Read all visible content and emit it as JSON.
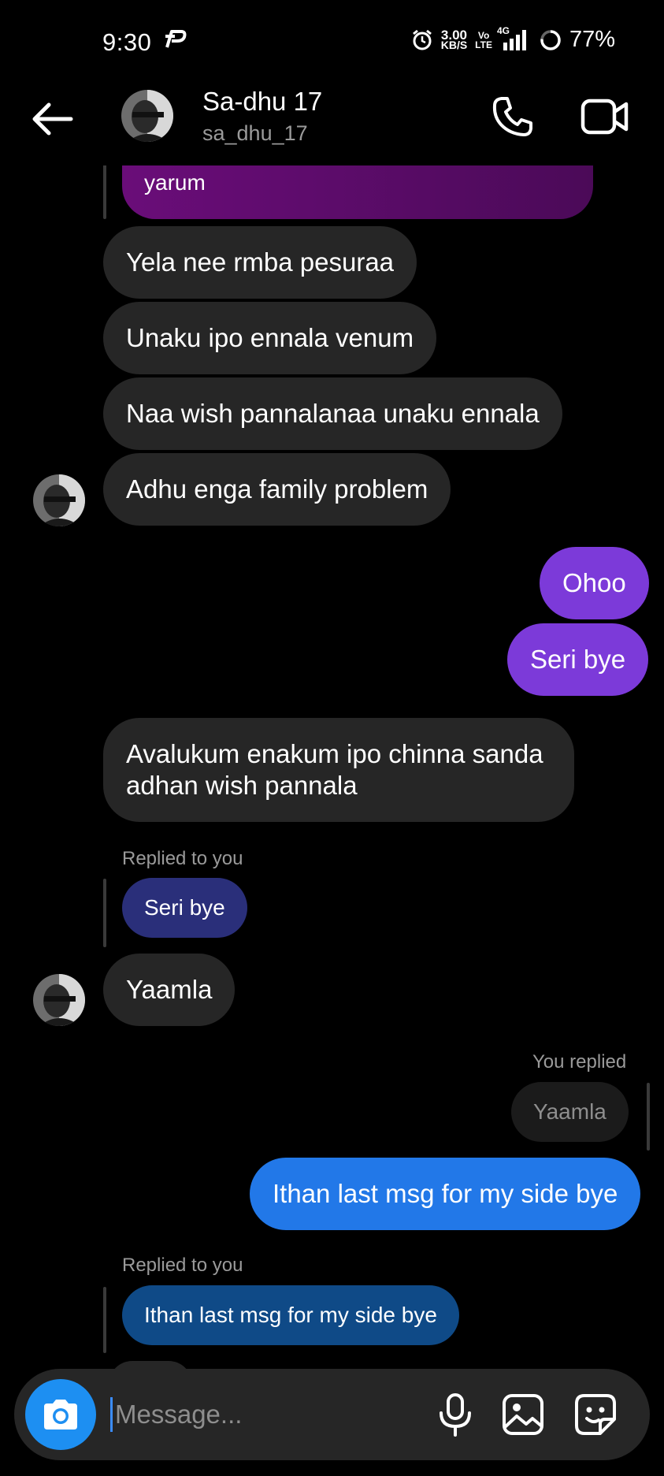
{
  "status_bar": {
    "time": "9:30",
    "speed_value": "3.00",
    "speed_unit": "KB/S",
    "volte_top": "Vo",
    "volte_bottom": "LTE",
    "network": "4G",
    "battery": "77%"
  },
  "header": {
    "name": "Sa-dhu 17",
    "handle": "sa_dhu_17"
  },
  "messages": {
    "top_partial": "yarum",
    "m1": "Yela nee rmba pesuraa",
    "m2": "Unaku ipo ennala venum",
    "m3": "Naa wish pannalanaa unaku ennala",
    "m4": "Adhu enga family problem",
    "m5": "Ohoo",
    "m6": "Seri bye",
    "m7_line1": "Avalukum enakum ipo chinna sanda",
    "m7_line2": "adhan wish pannala",
    "r1_label": "Replied to you",
    "r1_quote": "Seri bye",
    "m8": "Yaamla",
    "r2_label": "You replied",
    "r2_quote": "Yaamla",
    "m9": "Ithan last msg for my side bye",
    "r3_label": "Replied to you",
    "r3_quote": "Ithan last msg for my side bye"
  },
  "composer": {
    "placeholder": "Message..."
  },
  "colors": {
    "background": "#000000",
    "received_bubble": "#262626",
    "sent_purple": "#7541d8",
    "sent_blue": "#2278e8",
    "camera_button": "#1d8ff2",
    "top_quote": "#5a0a66",
    "reply_quote_navy": "#2a2f7a",
    "reply_quote_blue": "#0f4a87"
  }
}
